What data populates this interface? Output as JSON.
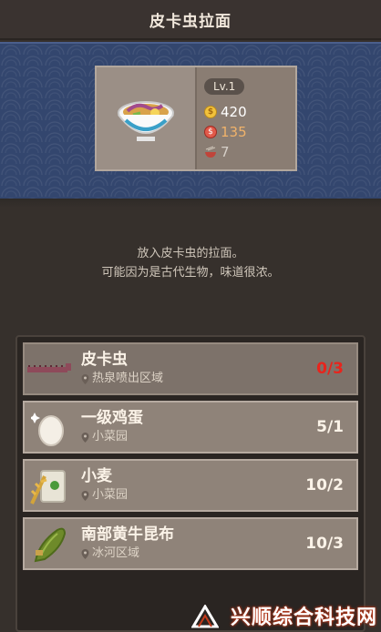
{
  "header": {
    "title": "皮卡虫拉面"
  },
  "item": {
    "level": "Lv.1",
    "gold": "420",
    "price": "135",
    "time": "7"
  },
  "description": {
    "line1": "放入皮卡虫的拉面。",
    "line2": "可能因为是古代生物，味道很浓。"
  },
  "ingredients": [
    {
      "name": "皮卡虫",
      "location": "热泉喷出区域",
      "count": "0/3",
      "status_color": "#e8241c"
    },
    {
      "name": "一级鸡蛋",
      "location": "小菜园",
      "count": "5/1"
    },
    {
      "name": "小麦",
      "location": "小菜园",
      "count": "10/2"
    },
    {
      "name": "南部黄牛昆布",
      "location": "冰河区域",
      "count": "10/3"
    }
  ],
  "watermark": {
    "text": "兴顺综合科技网"
  },
  "colors": {
    "banner": "#33466e",
    "panel": "#2a2522",
    "row": "#8f8379",
    "missing_count": "#e8241c"
  }
}
